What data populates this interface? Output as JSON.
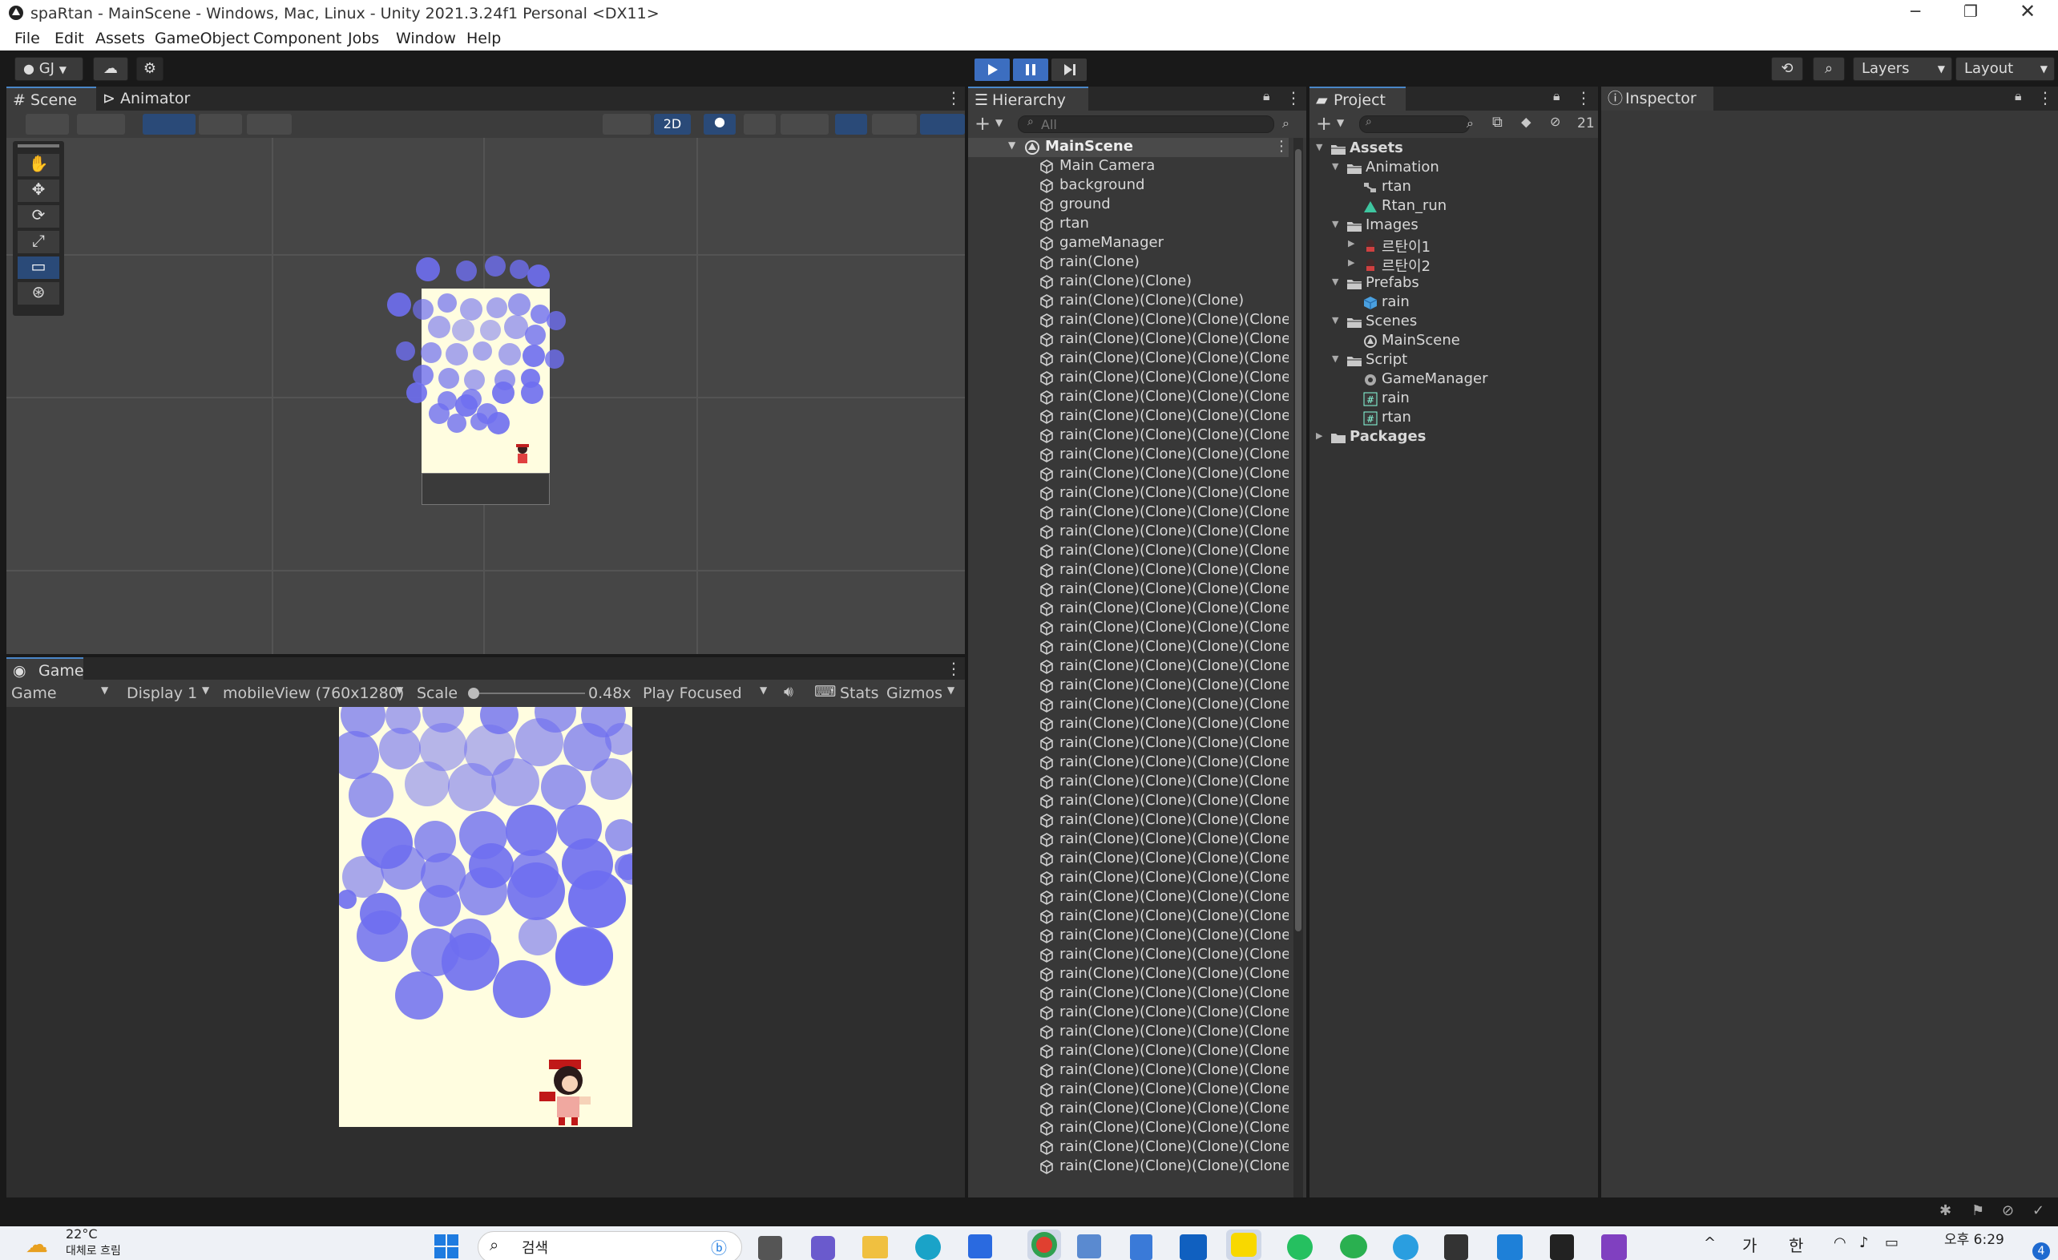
{
  "window": {
    "title": "spaRtan - MainScene - Windows, Mac, Linux - Unity 2021.3.24f1 Personal <DX11>"
  },
  "menu": [
    "File",
    "Edit",
    "Assets",
    "GameObject",
    "Component",
    "Jobs",
    "Window",
    "Help"
  ],
  "toolbar": {
    "account": "GJ",
    "layers": "Layers",
    "layout": "Layout"
  },
  "scene_panel": {
    "tabs": [
      "Scene",
      "Animator"
    ],
    "mode_2d": "2D"
  },
  "game_panel": {
    "tab": "Game",
    "view_mode": "Game",
    "display": "Display 1",
    "resolution": "mobileView (760x1280)",
    "scale_label": "Scale",
    "scale_value": "0.48x",
    "play_mode": "Play Focused",
    "stats": "Stats",
    "gizmos": "Gizmos",
    "scale_fraction": 0.0
  },
  "hierarchy": {
    "tab": "Hierarchy",
    "search_placeholder": "All",
    "root": "MainScene",
    "items": [
      "Main Camera",
      "background",
      "ground",
      "rtan",
      "gameManager",
      "rain(Clone)",
      "rain(Clone)(Clone)",
      "rain(Clone)(Clone)(Clone)"
    ],
    "clone_label": "rain(Clone)(Clone)(Clone)(Clone",
    "clone_count": 45
  },
  "project": {
    "tab": "Project",
    "hidden_count": "21",
    "tree": [
      {
        "label": "Assets",
        "depth": 0,
        "type": "folder-open",
        "bold": true
      },
      {
        "label": "Animation",
        "depth": 1,
        "type": "folder-open"
      },
      {
        "label": "rtan",
        "depth": 2,
        "type": "animator"
      },
      {
        "label": "Rtan_run",
        "depth": 2,
        "type": "anim"
      },
      {
        "label": "Images",
        "depth": 1,
        "type": "folder-open"
      },
      {
        "label": "르탄이1",
        "depth": 2,
        "type": "sprite"
      },
      {
        "label": "르탄이2",
        "depth": 2,
        "type": "sprite"
      },
      {
        "label": "Prefabs",
        "depth": 1,
        "type": "folder-open"
      },
      {
        "label": "rain",
        "depth": 2,
        "type": "prefab"
      },
      {
        "label": "Scenes",
        "depth": 1,
        "type": "folder-open"
      },
      {
        "label": "MainScene",
        "depth": 2,
        "type": "scene"
      },
      {
        "label": "Script",
        "depth": 1,
        "type": "folder-open"
      },
      {
        "label": "GameManager",
        "depth": 2,
        "type": "gear"
      },
      {
        "label": "rain",
        "depth": 2,
        "type": "script"
      },
      {
        "label": "rtan",
        "depth": 2,
        "type": "script"
      },
      {
        "label": "Packages",
        "depth": 0,
        "type": "folder",
        "bold": true
      }
    ]
  },
  "inspector": {
    "tab": "Inspector"
  },
  "taskbar": {
    "temperature": "22°C",
    "weather_text": "대체로 흐림",
    "search_label": "검색",
    "time": "오후 6:29",
    "ime_1": "가",
    "ime_2": "한",
    "badge": "4"
  },
  "colors": {
    "rain": "#6e6ef0",
    "background": "#fffde0",
    "accent": "#4a86c8"
  }
}
